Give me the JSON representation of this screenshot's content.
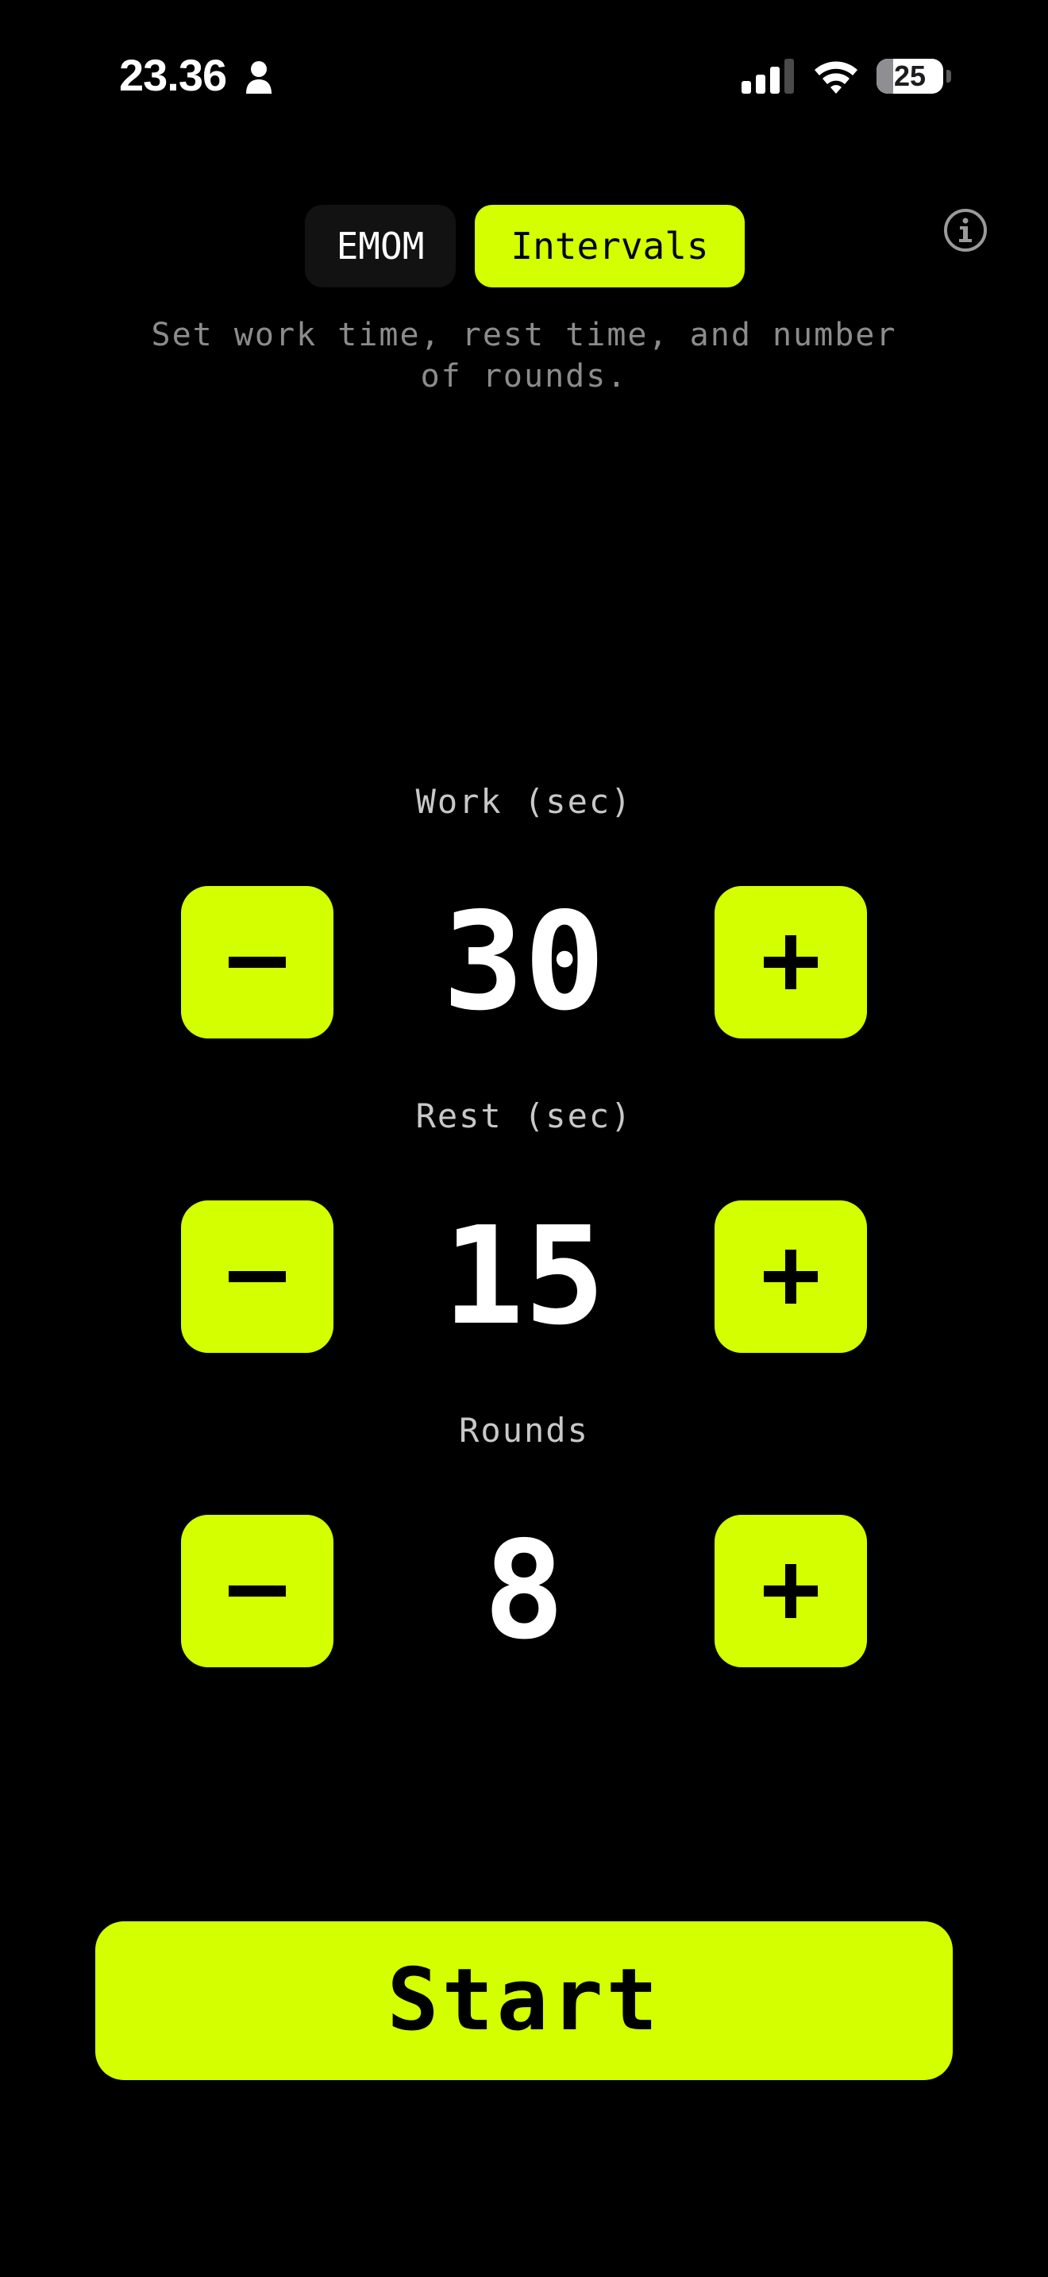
{
  "status_bar": {
    "time": "23.36",
    "battery_level": "25",
    "icons": [
      "person-icon",
      "signal-icon",
      "wifi-icon",
      "battery-icon"
    ]
  },
  "tabs": [
    {
      "label": "EMOM",
      "selected": false
    },
    {
      "label": "Intervals",
      "selected": true
    }
  ],
  "info_icon": "info-icon",
  "description": "Set work time, rest time, and number of rounds.",
  "fields": {
    "work": {
      "label": "Work (sec)",
      "value": "30"
    },
    "rest": {
      "label": "Rest (sec)",
      "value": "15"
    },
    "rounds": {
      "label": "Rounds",
      "value": "8"
    }
  },
  "stepper_icons": [
    "minus-icon",
    "plus-icon"
  ],
  "start_label": "Start",
  "colors": {
    "accent": "#d4ff00",
    "background": "#000000",
    "tab_inactive": "#121212",
    "muted_text": "#8c8c8c",
    "label_text": "#c8c8c8"
  }
}
